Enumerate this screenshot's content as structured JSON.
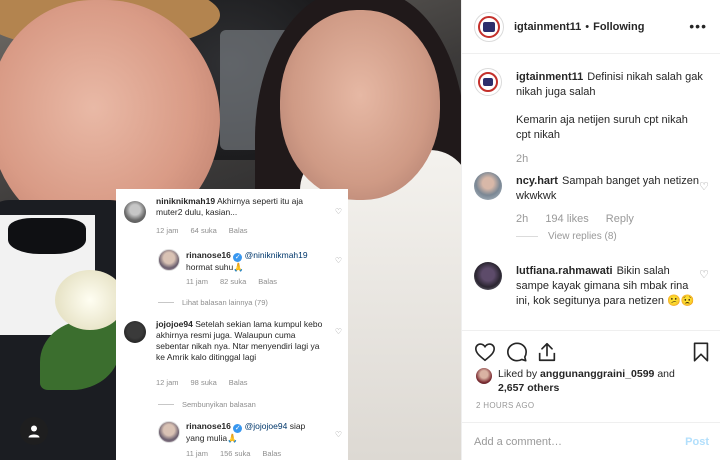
{
  "overlay": {
    "comments": [
      {
        "user": "niniknikmah19",
        "text": "Akhirnya seperti itu aja muter2 dulu, kasian...",
        "time": "12 jam",
        "likes": "64 suka",
        "reply": "Balas"
      },
      {
        "user": "rinanose16",
        "mention": "@niniknikmah19",
        "text": "hormat suhu🙏",
        "time": "11 jam",
        "likes": "82 suka",
        "reply": "Balas"
      },
      {
        "user": "jojojoe94",
        "text": "Setelah sekian lama kumpul kebo akhirnya resmi juga. Walaupun cuma sebentar nikah nya. Ntar menyendiri lagi ya ke Amrik kalo ditinggal lagi",
        "time": "12 jam",
        "likes": "98 suka",
        "reply": "Balas"
      },
      {
        "user": "rinanose16",
        "mention": "@jojojoe94",
        "text": "siap yang mulia🙏",
        "time": "11 jam",
        "likes": "156 suka",
        "reply": "Balas"
      }
    ],
    "see_other_replies": "Lihat balasan lainnya (79)",
    "hide_replies": "Sembunyikan balasan"
  },
  "header": {
    "username": "igtainment11",
    "separator": "•",
    "follow_status": "Following",
    "more": "•••"
  },
  "caption": {
    "username": "igtainment11",
    "text": "Definisi nikah salah gak nikah juga salah",
    "text2": "Kemarin aja netijen suruh cpt nikah cpt nikah",
    "time": "2h"
  },
  "comments": [
    {
      "username": "ncy.hart",
      "text": "Sampah banget yah netizen wkwkwk",
      "time": "2h",
      "likes": "194 likes",
      "reply": "Reply",
      "view_replies": "View replies (8)"
    },
    {
      "username": "lutfiana.rahmawati",
      "text": "Bikin salah sampe kayak gimana sih mbak rina ini, kok segitunya para netizen 😕😟"
    }
  ],
  "likes": {
    "prefix": "Liked by",
    "user": "anggunanggraini_0599",
    "conj": "and",
    "others": "2,657 others"
  },
  "timestamp": "2 HOURS AGO",
  "add_comment": {
    "placeholder": "Add a comment…",
    "post": "Post"
  },
  "icons": {
    "heart": "heart-icon",
    "comment": "comment-icon",
    "share": "share-icon",
    "save": "bookmark-icon",
    "user_tag": "user-icon"
  },
  "colors": {
    "text": "#262626",
    "muted": "#999999",
    "border": "#efefef",
    "post_disabled": "#b2dffc",
    "verified": "#3897f0"
  }
}
